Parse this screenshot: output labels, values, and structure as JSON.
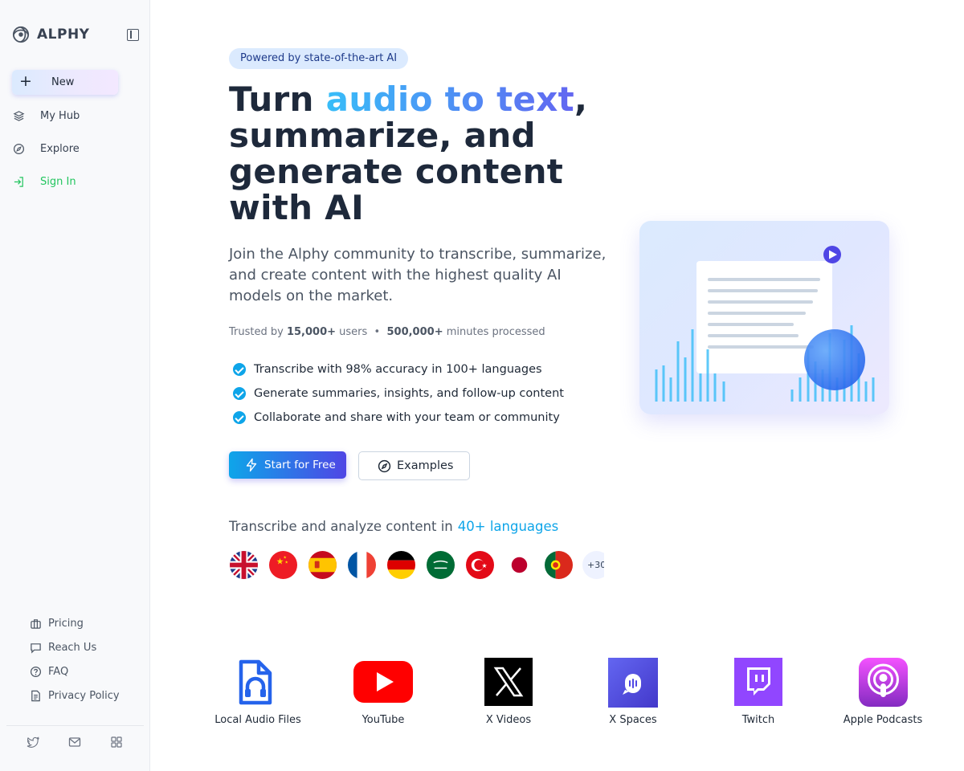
{
  "sidebar": {
    "brand": "ALPHY",
    "new_label": "New",
    "nav": [
      {
        "label": "My Hub",
        "icon": "layers-icon"
      },
      {
        "label": "Explore",
        "icon": "compass-icon"
      },
      {
        "label": "Sign In",
        "icon": "sign-in-icon"
      }
    ],
    "footer": [
      {
        "label": "Pricing",
        "icon": "briefcase-icon"
      },
      {
        "label": "Reach Us",
        "icon": "message-icon"
      },
      {
        "label": "FAQ",
        "icon": "question-icon"
      },
      {
        "label": "Privacy Policy",
        "icon": "document-icon"
      }
    ],
    "social": [
      "twitter-icon",
      "mail-icon",
      "apps-icon"
    ]
  },
  "hero": {
    "badge": "Powered by state-of-the-art AI",
    "headline_pre": "Turn ",
    "headline_highlight": "audio to text",
    "headline_post": ", summarize, and generate content with AI",
    "subtext": "Join the Alphy community to transcribe, summarize, and create content with the highest quality AI models on the market.",
    "trusted_prefix": "Trusted by ",
    "users_count": "15,000+",
    "users_label": " users",
    "separator": "•",
    "minutes_count": "500,000+",
    "minutes_label": " minutes processed",
    "features": [
      "Transcribe with 98% accuracy in 100+ languages",
      "Generate summaries, insights, and follow-up content",
      "Collaborate and share with your team or community"
    ],
    "cta_label": "Start for Free",
    "examples_label": "Examples"
  },
  "languages": {
    "intro": "Transcribe and analyze content in",
    "highlight": "40+ languages",
    "flags": [
      "uk-flag",
      "china-flag",
      "spain-flag",
      "france-flag",
      "germany-flag",
      "saudi-flag",
      "turkey-flag",
      "japan-flag",
      "portugal-flag"
    ],
    "more": "+30"
  },
  "sources": [
    {
      "label": "Local Audio Files",
      "icon": "audio-file-icon"
    },
    {
      "label": "YouTube",
      "icon": "youtube-icon"
    },
    {
      "label": "X Videos",
      "icon": "x-logo-icon"
    },
    {
      "label": "X Spaces",
      "icon": "x-spaces-mic-icon"
    },
    {
      "label": "Twitch",
      "icon": "twitch-icon"
    },
    {
      "label": "Apple Podcasts",
      "icon": "apple-podcasts-icon"
    }
  ],
  "colors": {
    "accent": "#0ea5e9",
    "accent_indigo": "#4f46e5",
    "signin_green": "#22c55e",
    "youtube_red": "#ff0000",
    "twitch_purple": "#9146ff"
  }
}
